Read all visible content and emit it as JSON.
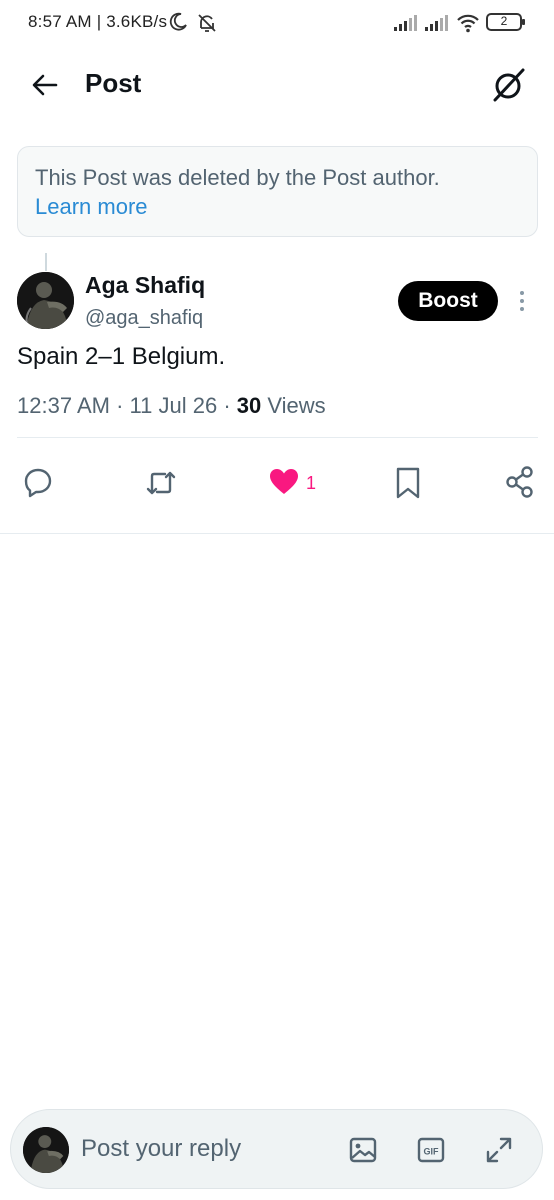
{
  "status_bar": {
    "time_speed": "8:57 AM | 3.6KB/s",
    "battery": "2"
  },
  "header": {
    "title": "Post"
  },
  "deleted_notice": {
    "text": "This Post was deleted by the Post author.",
    "link": "Learn more"
  },
  "post": {
    "author_name": "Aga Shafiq",
    "author_handle": "@aga_shafiq",
    "boost_label": "Boost",
    "text": "Spain 2–1 Belgium.",
    "time": "12:37 AM",
    "date": "11 Jul 26",
    "views_count": "30",
    "views_label": "Views",
    "like_count": "1",
    "liked": true
  },
  "reply_bar": {
    "placeholder": "Post your reply"
  },
  "icons": {
    "back": "back-arrow-icon",
    "grok": "grok-icon",
    "more": "more-vertical-icon",
    "reply": "reply-icon",
    "retweet": "retweet-icon",
    "like": "heart-icon",
    "bookmark": "bookmark-icon",
    "share": "share-icon",
    "image": "image-icon",
    "gif": "gif-icon",
    "expand": "expand-icon"
  },
  "colors": {
    "like": "#f91880",
    "link": "#2a8bd4",
    "secondary_text": "#536471",
    "primary_text": "#0f1419"
  }
}
